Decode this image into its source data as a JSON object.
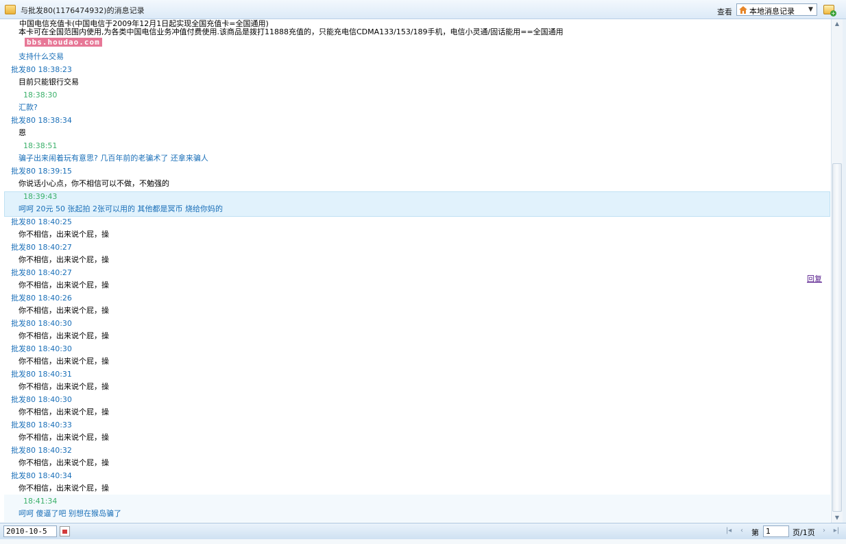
{
  "window": {
    "title": "与批发80(1176474932)的消息记录",
    "view_label": "查看",
    "view_select": "本地消息记录"
  },
  "watermark": {
    "text": "bbs.houdao.com"
  },
  "intro": {
    "line1": "中国电信充值卡(中国电信于2009年12月1日起实现全国充值卡=全国通用)",
    "line2": "本卡可在全国范围内使用,为各类中国电信业务冲值付费使用.该商品是拨打11888充值的，只能充电信CDMA133/153/189手机，电信小灵通/固话能用==全国通用"
  },
  "messages": [
    {
      "type": "self-msg",
      "text": "支持什么交易"
    },
    {
      "type": "sender-line",
      "text": "批发80 18:38:23"
    },
    {
      "type": "other-msg",
      "text": "目前只能银行交易"
    },
    {
      "type": "self-time",
      "text": "18:38:30"
    },
    {
      "type": "self-msg",
      "text": "汇款?"
    },
    {
      "type": "sender-line",
      "text": "批发80 18:38:34"
    },
    {
      "type": "other-msg",
      "text": "恩"
    },
    {
      "type": "self-time",
      "text": "18:38:51"
    },
    {
      "type": "self-msg",
      "text": "骗子出来闹着玩有意思? 几百年前的老骗术了 还拿来骗人"
    },
    {
      "type": "sender-line",
      "text": "批发80 18:39:15"
    },
    {
      "type": "other-msg",
      "text": "你说话小心点，你不相信可以不做，不勉强的"
    },
    {
      "type": "self-time",
      "text": "18:39:43"
    },
    {
      "type": "self-msg",
      "text": "呵呵 20元 50 张起拍 2张可以用的 其他都是冥币 烧给你妈的"
    },
    {
      "type": "sender-line",
      "text": "批发80 18:40:25"
    },
    {
      "type": "other-msg",
      "text": "你不相信，出来说个屁，操"
    },
    {
      "type": "sender-line",
      "text": "批发80 18:40:27"
    },
    {
      "type": "other-msg",
      "text": "你不相信，出来说个屁，操"
    },
    {
      "type": "sender-line",
      "text": "批发80 18:40:27"
    },
    {
      "type": "other-msg",
      "text": "你不相信，出来说个屁，操"
    },
    {
      "type": "sender-line",
      "text": "批发80 18:40:26"
    },
    {
      "type": "other-msg",
      "text": "你不相信，出来说个屁，操"
    },
    {
      "type": "sender-line",
      "text": "批发80 18:40:30"
    },
    {
      "type": "other-msg",
      "text": "你不相信，出来说个屁，操"
    },
    {
      "type": "sender-line",
      "text": "批发80 18:40:30"
    },
    {
      "type": "other-msg",
      "text": "你不相信，出来说个屁，操"
    },
    {
      "type": "sender-line",
      "text": "批发80 18:40:31"
    },
    {
      "type": "other-msg",
      "text": "你不相信，出来说个屁，操"
    },
    {
      "type": "sender-line",
      "text": "批发80 18:40:30"
    },
    {
      "type": "other-msg",
      "text": "你不相信，出来说个屁，操"
    },
    {
      "type": "sender-line",
      "text": "批发80 18:40:33"
    },
    {
      "type": "other-msg",
      "text": "你不相信，出来说个屁，操"
    },
    {
      "type": "sender-line",
      "text": "批发80 18:40:32"
    },
    {
      "type": "other-msg",
      "text": "你不相信，出来说个屁，操"
    },
    {
      "type": "sender-line",
      "text": "批发80 18:40:34"
    },
    {
      "type": "other-msg",
      "text": "你不相信，出来说个屁，操"
    },
    {
      "type": "self-time",
      "text": "18:41:34"
    },
    {
      "type": "self-msg",
      "text": "呵呵 傻逼了吧  别想在猴岛骗了"
    }
  ],
  "reply_link": "回复",
  "footer": {
    "date": "2010-10-5",
    "page_prefix": "第",
    "page_value": "1",
    "page_suffix": "页/1页"
  },
  "icons": {
    "title": "chat-icon",
    "view": "home-icon",
    "tool": "add-contact-icon",
    "calendar": "calendar-icon",
    "first": "first-page-icon",
    "prev": "prev-page-icon",
    "next": "next-page-icon",
    "last": "last-page-icon"
  },
  "colors": {
    "sender": "#1a6fb8",
    "self_time": "#3bb06a",
    "highlight_bg": "#e1f2fc"
  }
}
